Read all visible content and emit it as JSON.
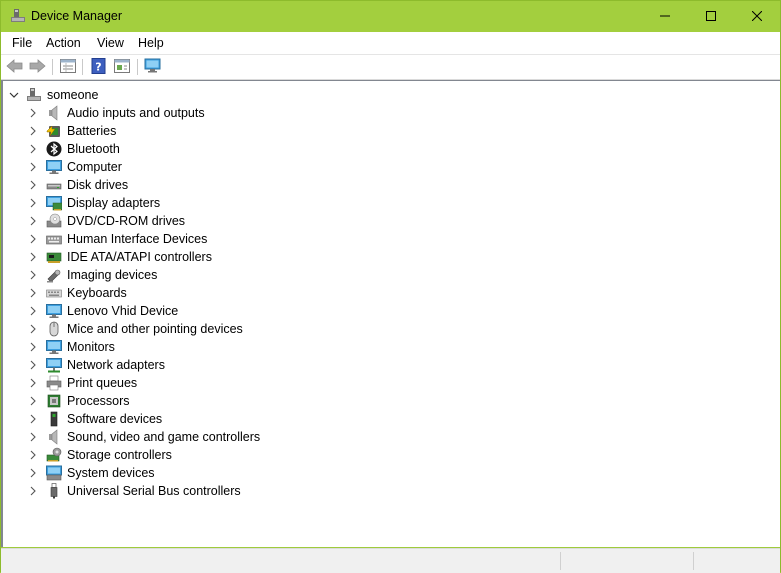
{
  "window": {
    "title": "Device Manager",
    "accent_color": "#a3cf3e"
  },
  "menu": {
    "items": [
      "File",
      "Action",
      "View",
      "Help"
    ]
  },
  "tree": {
    "root": "someone",
    "items": [
      {
        "label": "Audio inputs and outputs",
        "icon": "speaker-icon"
      },
      {
        "label": "Batteries",
        "icon": "battery-icon"
      },
      {
        "label": "Bluetooth",
        "icon": "bluetooth-icon"
      },
      {
        "label": "Computer",
        "icon": "computer-icon"
      },
      {
        "label": "Disk drives",
        "icon": "disk-drive-icon"
      },
      {
        "label": "Display adapters",
        "icon": "display-adapter-icon"
      },
      {
        "label": "DVD/CD-ROM drives",
        "icon": "dvd-drive-icon"
      },
      {
        "label": "Human Interface Devices",
        "icon": "hid-icon"
      },
      {
        "label": "IDE ATA/ATAPI controllers",
        "icon": "ide-controller-icon"
      },
      {
        "label": "Imaging devices",
        "icon": "camera-icon"
      },
      {
        "label": "Keyboards",
        "icon": "keyboard-icon"
      },
      {
        "label": "Lenovo Vhid Device",
        "icon": "monitor-icon"
      },
      {
        "label": "Mice and other pointing devices",
        "icon": "mouse-icon"
      },
      {
        "label": "Monitors",
        "icon": "monitor-icon"
      },
      {
        "label": "Network adapters",
        "icon": "network-adapter-icon"
      },
      {
        "label": "Print queues",
        "icon": "printer-icon"
      },
      {
        "label": "Processors",
        "icon": "processor-icon"
      },
      {
        "label": "Software devices",
        "icon": "software-device-icon"
      },
      {
        "label": "Sound, video and game controllers",
        "icon": "speaker-icon"
      },
      {
        "label": "Storage controllers",
        "icon": "storage-controller-icon"
      },
      {
        "label": "System devices",
        "icon": "system-devices-icon"
      },
      {
        "label": "Universal Serial Bus controllers",
        "icon": "usb-icon"
      }
    ]
  }
}
